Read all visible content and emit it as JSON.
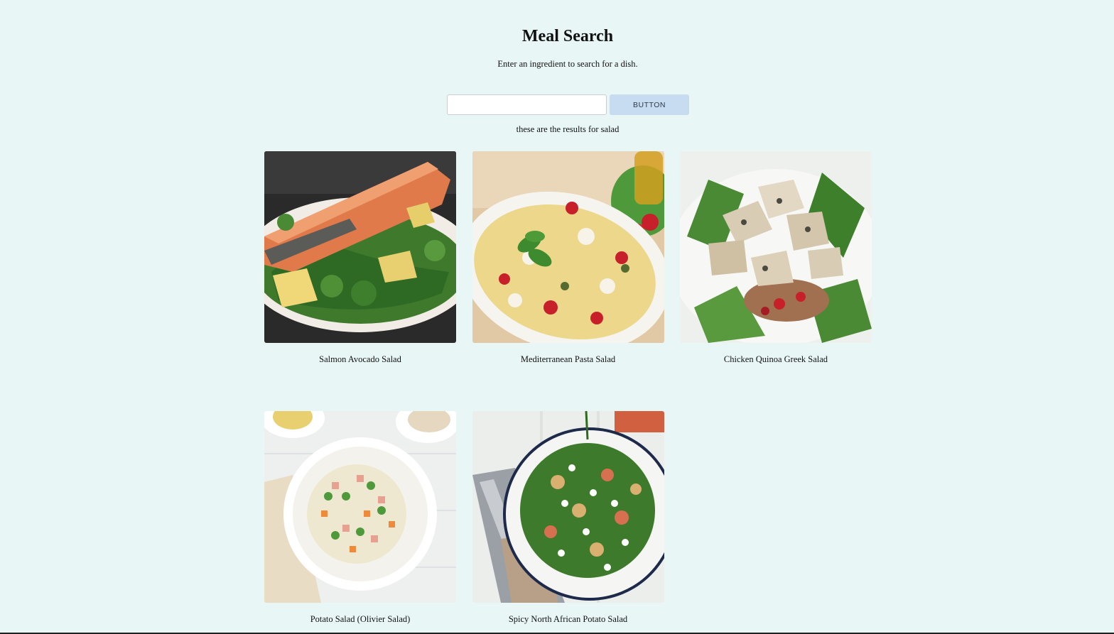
{
  "header": {
    "title": "Meal Search",
    "subtitle": "Enter an ingredient to search for a dish."
  },
  "search": {
    "value": "",
    "placeholder": "",
    "button_label": "BUTTON"
  },
  "results": {
    "summary": "these are the results for salad",
    "items": [
      {
        "title": "Salmon Avocado Salad",
        "image": "salmon-avocado-salad-photo"
      },
      {
        "title": "Mediterranean Pasta Salad",
        "image": "mediterranean-pasta-salad-photo"
      },
      {
        "title": "Chicken Quinoa Greek Salad",
        "image": "chicken-quinoa-greek-salad-photo"
      },
      {
        "title": "Potato Salad (Olivier Salad)",
        "image": "potato-salad-olivier-photo"
      },
      {
        "title": "Spicy North African Potato Salad",
        "image": "spicy-north-african-potato-salad-photo"
      }
    ]
  },
  "colors": {
    "page_background": "#e9f6f6",
    "button_background": "#c7dcf0",
    "text": "#111111"
  }
}
